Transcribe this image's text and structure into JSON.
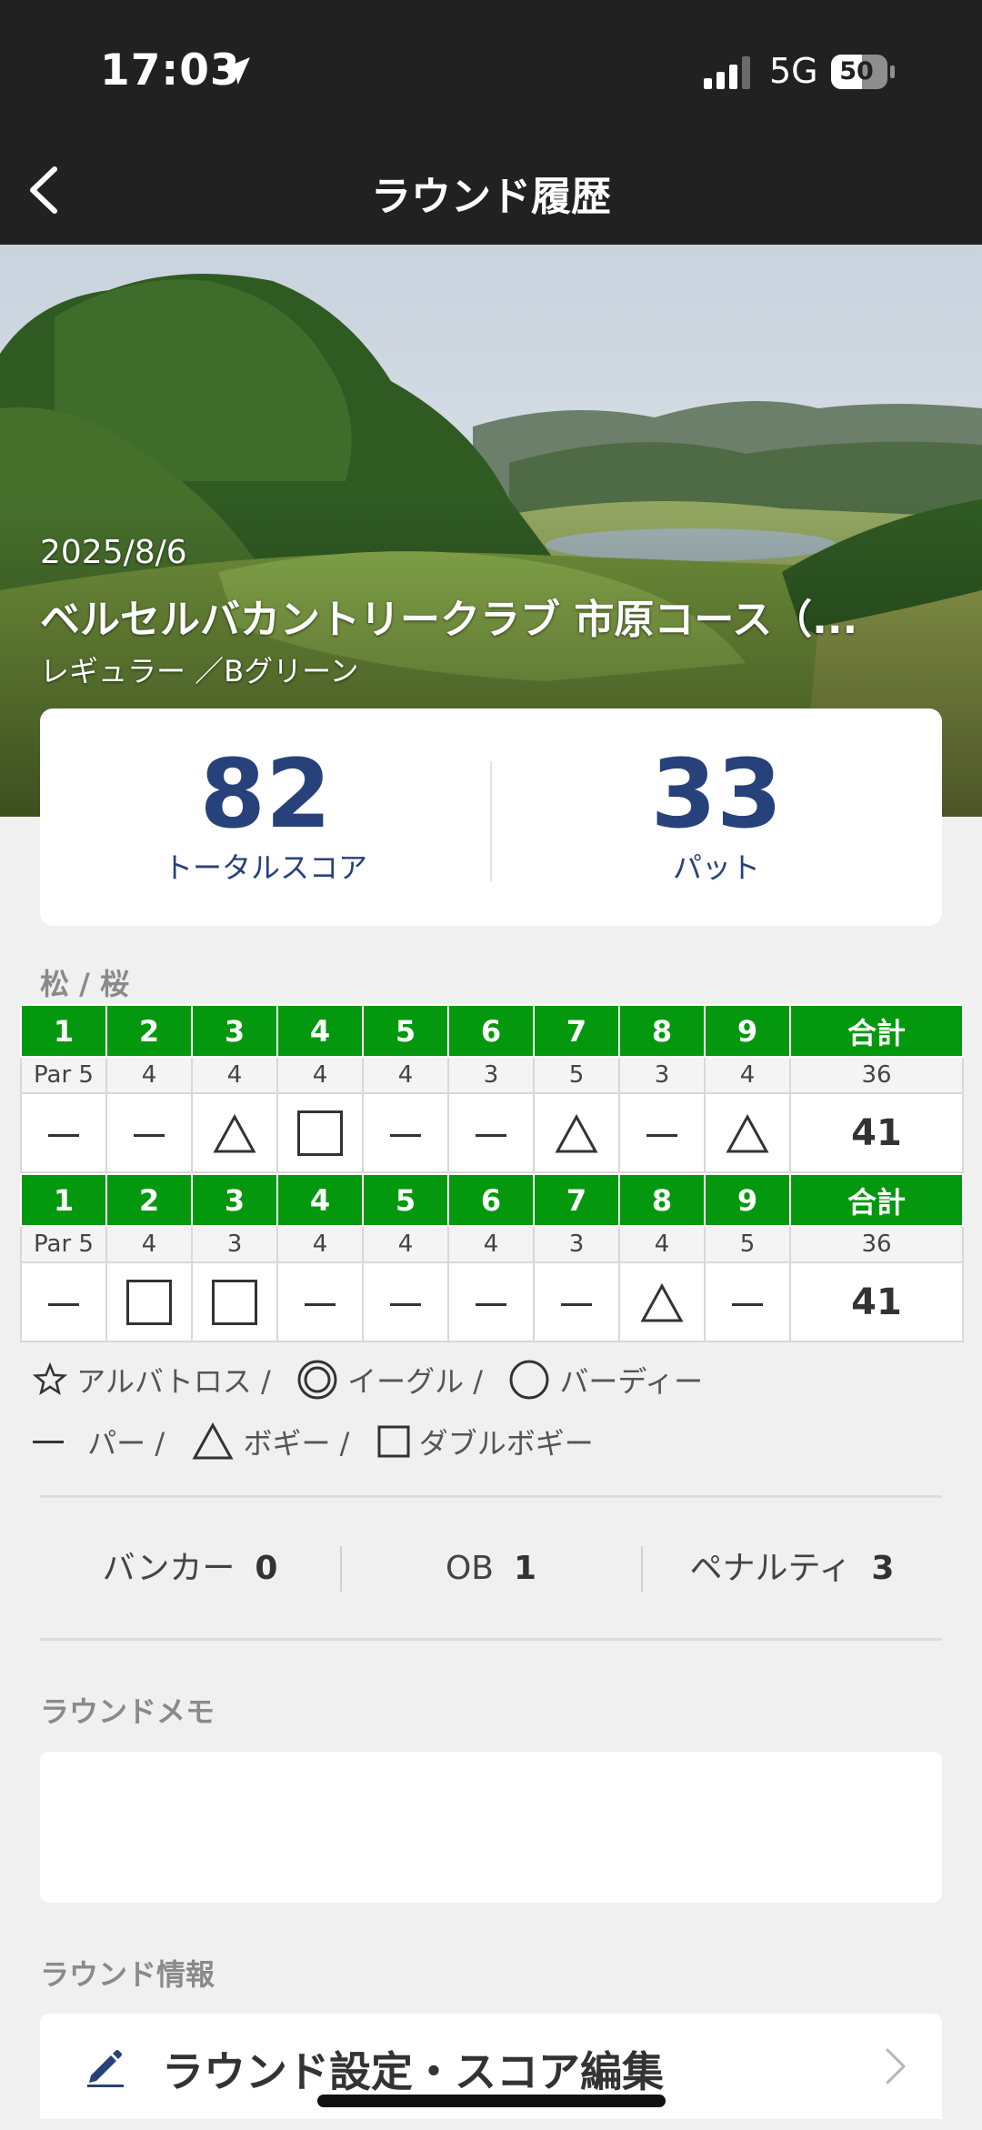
{
  "status_bar": {
    "time": "17:03",
    "network": "5G",
    "battery": "50"
  },
  "nav": {
    "title": "ラウンド履歴"
  },
  "round": {
    "date": "2025/8/6",
    "course": "ベルセルバカントリークラブ 市原コース（...",
    "tee_green": "レギュラー ／Bグリーン"
  },
  "summary": {
    "total_score": "82",
    "total_score_label": "トータルスコア",
    "putts": "33",
    "putts_label": "パット"
  },
  "course_label": "松 / 桜",
  "tables": [
    {
      "holes": [
        "1",
        "2",
        "3",
        "4",
        "5",
        "6",
        "7",
        "8",
        "9",
        "合計"
      ],
      "pars": [
        "Par 5",
        "4",
        "4",
        "4",
        "4",
        "3",
        "5",
        "3",
        "4",
        "36"
      ],
      "scores": [
        "par",
        "par",
        "bogey",
        "double",
        "par",
        "par",
        "bogey",
        "par",
        "bogey"
      ],
      "total": "41"
    },
    {
      "holes": [
        "1",
        "2",
        "3",
        "4",
        "5",
        "6",
        "7",
        "8",
        "9",
        "合計"
      ],
      "pars": [
        "Par 5",
        "4",
        "3",
        "4",
        "4",
        "4",
        "3",
        "4",
        "5",
        "36"
      ],
      "scores": [
        "par",
        "double",
        "double",
        "par",
        "par",
        "par",
        "par",
        "bogey",
        "par"
      ],
      "total": "41"
    }
  ],
  "legend": {
    "albatross": "アルバトロス /",
    "eagle": "イーグル /",
    "birdie": "バーディー",
    "par": "パー /",
    "bogey": "ボギー /",
    "double": "ダブルボギー"
  },
  "stats": {
    "bunker_label": "バンカー",
    "bunker": "0",
    "ob_label": "OB",
    "ob": "1",
    "penalty_label": "ペナルティ",
    "penalty": "3"
  },
  "memo": {
    "label": "ラウンドメモ",
    "text": ""
  },
  "info": {
    "label": "ラウンド情報",
    "settings": "ラウンド設定・スコア編集"
  },
  "colors": {
    "header": "#212121",
    "hole_green": "#03980e",
    "score_blue": "#27427a"
  }
}
